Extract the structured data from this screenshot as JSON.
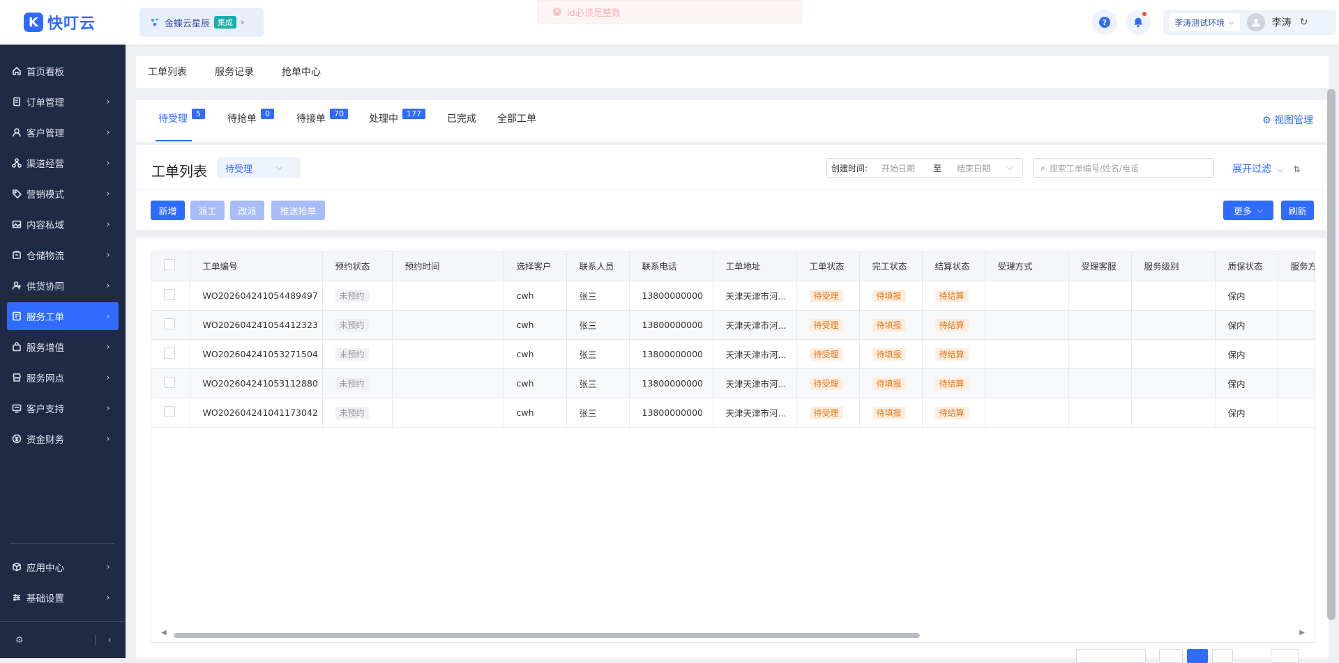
{
  "app": {
    "name": "快叮云"
  },
  "topbar": {
    "brand": "金蝶云星辰",
    "brand_tag": "集成",
    "toast": "id必须是整数",
    "env": "李涛测试环境",
    "user": "李涛"
  },
  "sidebar": {
    "items": [
      {
        "label": "首页看板",
        "icon": "home-icon"
      },
      {
        "label": "订单管理",
        "icon": "order-icon"
      },
      {
        "label": "客户管理",
        "icon": "user-icon"
      },
      {
        "label": "渠道经营",
        "icon": "channel-icon"
      },
      {
        "label": "营销模式",
        "icon": "tag-icon"
      },
      {
        "label": "内容私域",
        "icon": "image-icon"
      },
      {
        "label": "仓储物流",
        "icon": "warehouse-icon"
      },
      {
        "label": "供货协同",
        "icon": "handshake-icon"
      },
      {
        "label": "服务工单",
        "icon": "ticket-icon"
      },
      {
        "label": "服务增值",
        "icon": "bag-icon"
      },
      {
        "label": "服务网点",
        "icon": "store-icon"
      },
      {
        "label": "客户支持",
        "icon": "support-icon"
      },
      {
        "label": "资金财务",
        "icon": "yen-icon"
      }
    ],
    "bottom_items": [
      {
        "label": "应用中心",
        "icon": "cube-icon"
      },
      {
        "label": "基础设置",
        "icon": "sliders-icon"
      }
    ],
    "active_index": 8
  },
  "subtabs": [
    "工单列表",
    "服务记录",
    "抢单中心"
  ],
  "status_tabs": [
    {
      "label": "待受理",
      "count": "5"
    },
    {
      "label": "待抢单",
      "count": "0"
    },
    {
      "label": "待接单",
      "count": "70"
    },
    {
      "label": "处理中",
      "count": "177"
    },
    {
      "label": "已完成",
      "count": ""
    },
    {
      "label": "全部工单",
      "count": ""
    }
  ],
  "view_manage": "视图管理",
  "list": {
    "title": "工单列表",
    "view_select": "待受理",
    "date_label": "创建时间:",
    "date_start_placeholder": "开始日期",
    "date_sep": "至",
    "date_end_placeholder": "结束日期",
    "search_placeholder": "搜索工单编号/姓名/电话",
    "expand_filter": "展开过滤"
  },
  "buttons": {
    "add": "新增",
    "dispatch": "派工",
    "reassign": "改派",
    "push_grab": "推送抢单",
    "more": "更多",
    "refresh": "刷新"
  },
  "table": {
    "columns": [
      "工单编号",
      "预约状态",
      "预约时间",
      "选择客户",
      "联系人员",
      "联系电话",
      "工单地址",
      "工单状态",
      "完工状态",
      "结算状态",
      "受理方式",
      "受理客服",
      "服务级别",
      "质保状态",
      "服务方"
    ],
    "rows": [
      {
        "no": "WO202604241054489497",
        "appt": "未预约",
        "appt_time": "",
        "customer": "cwh",
        "contact": "张三",
        "phone": "13800000000",
        "address": "天津天津市河...",
        "status": "待受理",
        "finish": "待填报",
        "settle": "待结算",
        "accept_way": "",
        "accept_cs": "",
        "level": "",
        "warranty": "保内"
      },
      {
        "no": "WO202604241054412323",
        "appt": "未预约",
        "appt_time": "",
        "customer": "cwh",
        "contact": "张三",
        "phone": "13800000000",
        "address": "天津天津市河...",
        "status": "待受理",
        "finish": "待填报",
        "settle": "待结算",
        "accept_way": "",
        "accept_cs": "",
        "level": "",
        "warranty": "保内"
      },
      {
        "no": "WO202604241053271504",
        "appt": "未预约",
        "appt_time": "",
        "customer": "cwh",
        "contact": "张三",
        "phone": "13800000000",
        "address": "天津天津市河...",
        "status": "待受理",
        "finish": "待填报",
        "settle": "待结算",
        "accept_way": "",
        "accept_cs": "",
        "level": "",
        "warranty": "保内"
      },
      {
        "no": "WO202604241053112880",
        "appt": "未预约",
        "appt_time": "",
        "customer": "cwh",
        "contact": "张三",
        "phone": "13800000000",
        "address": "天津天津市河...",
        "status": "待受理",
        "finish": "待填报",
        "settle": "待结算",
        "accept_way": "",
        "accept_cs": "",
        "level": "",
        "warranty": "保内"
      },
      {
        "no": "WO202604241041173042",
        "appt": "未预约",
        "appt_time": "",
        "customer": "cwh",
        "contact": "张三",
        "phone": "13800000000",
        "address": "天津天津市河...",
        "status": "待受理",
        "finish": "待填报",
        "settle": "待结算",
        "accept_way": "",
        "accept_cs": "",
        "level": "",
        "warranty": "保内"
      }
    ]
  },
  "colors": {
    "primary": "#2f6bff",
    "sidebar_bg": "#1f2a44",
    "tag_orange": "#e2761b"
  }
}
